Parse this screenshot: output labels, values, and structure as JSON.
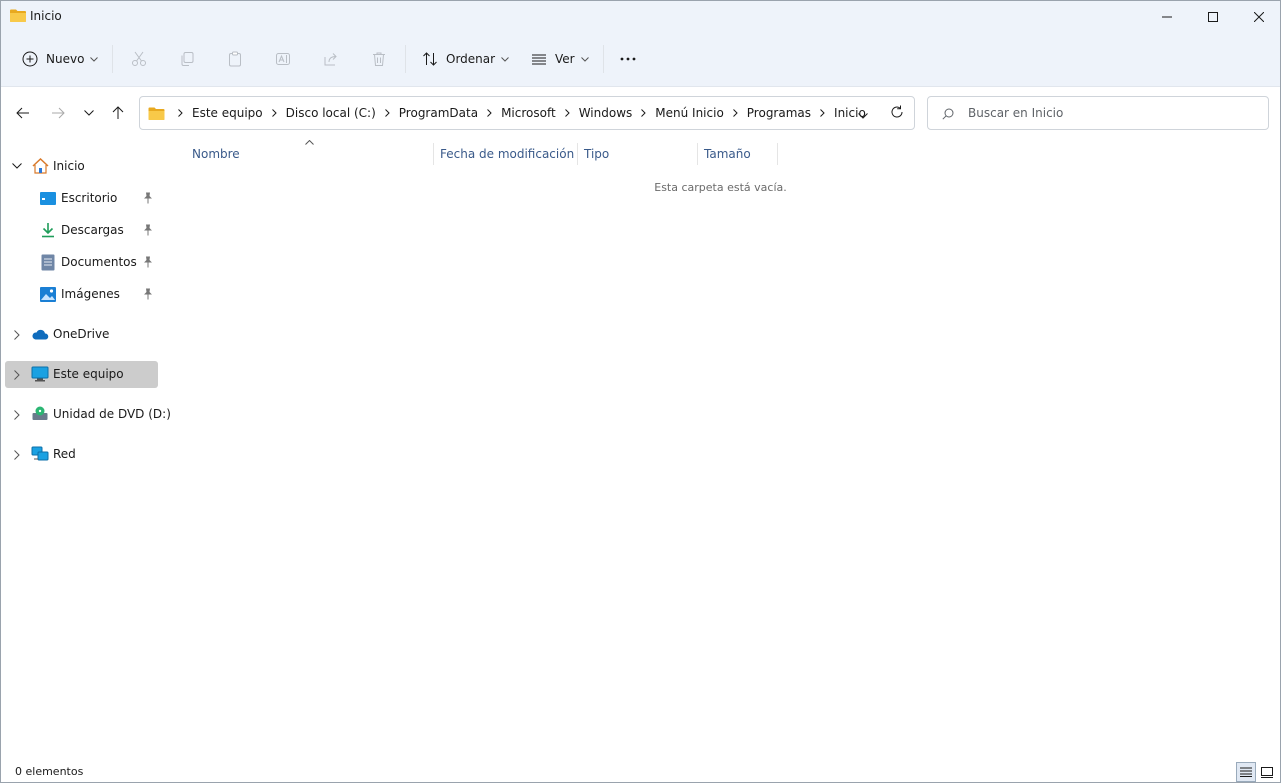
{
  "window": {
    "title": "Inicio"
  },
  "toolbar": {
    "new_label": "Nuevo",
    "sort_label": "Ordenar",
    "view_label": "Ver"
  },
  "address": {
    "crumbs": [
      "Este equipo",
      "Disco local (C:)",
      "ProgramData",
      "Microsoft",
      "Windows",
      "Menú Inicio",
      "Programas",
      "Inicio"
    ]
  },
  "search": {
    "placeholder": "Buscar en Inicio"
  },
  "sidebar": {
    "home": "Inicio",
    "quick": [
      {
        "label": "Escritorio",
        "icon": "desktop-icon"
      },
      {
        "label": "Descargas",
        "icon": "download-icon"
      },
      {
        "label": "Documentos",
        "icon": "document-icon"
      },
      {
        "label": "Imágenes",
        "icon": "pictures-icon"
      }
    ],
    "onedrive": "OneDrive",
    "this_pc": "Este equipo",
    "dvd": "Unidad de DVD (D:)",
    "network": "Red"
  },
  "columns": {
    "name": "Nombre",
    "date": "Fecha de modificación",
    "type": "Tipo",
    "size": "Tamaño"
  },
  "content": {
    "empty_text": "Esta carpeta está vacía."
  },
  "status": {
    "items": "0 elementos"
  },
  "colors": {
    "accent": "#0067c0",
    "folder": "#f5c043",
    "selected_nav": "#cccccc",
    "column_header": "#3a5a8a"
  }
}
